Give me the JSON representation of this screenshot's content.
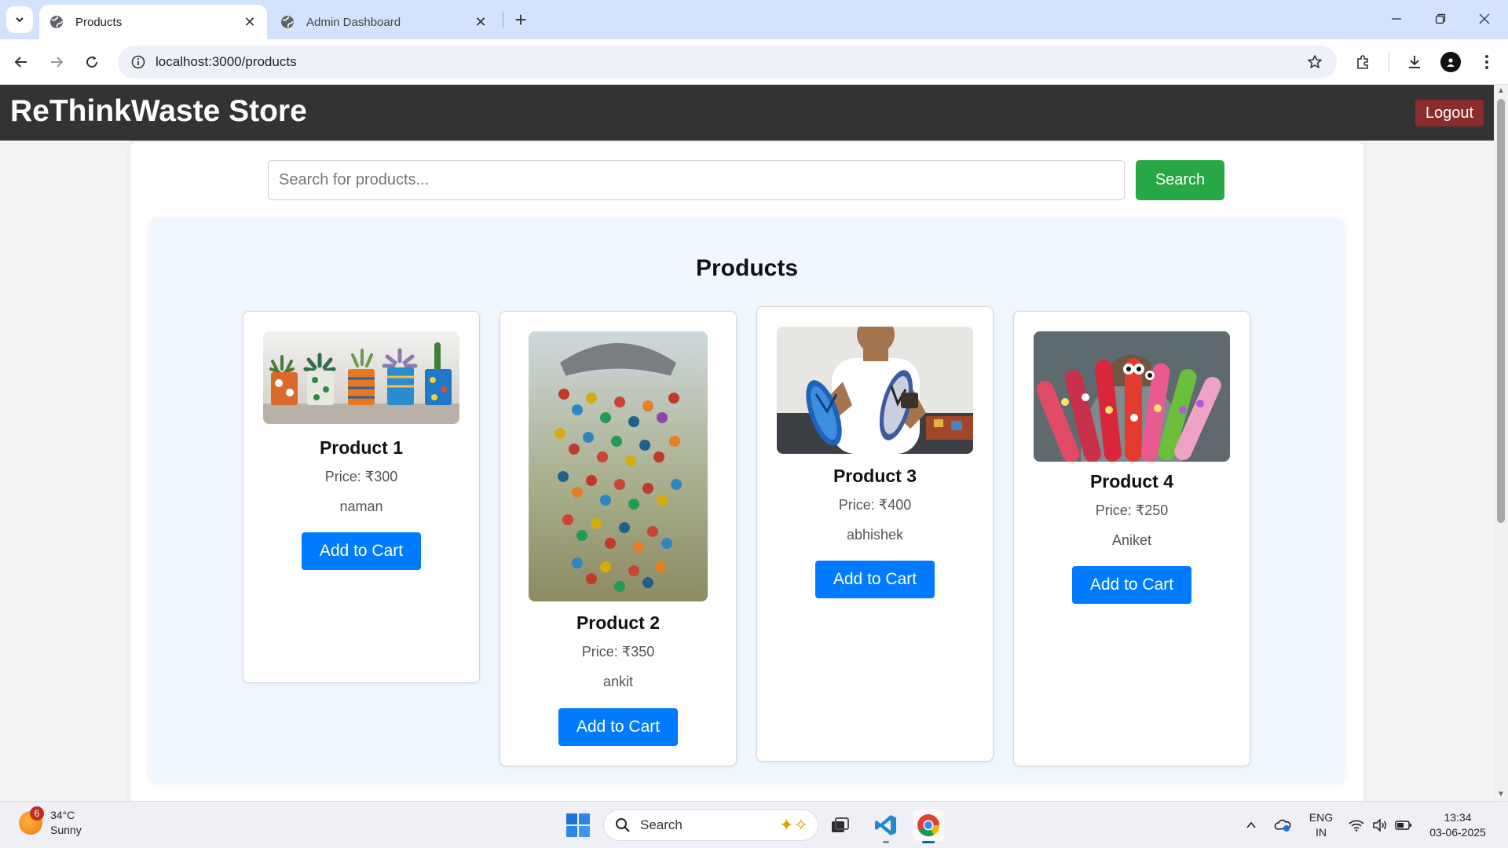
{
  "browser": {
    "tabs": [
      {
        "title": "Products",
        "active": true
      },
      {
        "title": "Admin Dashboard",
        "active": false
      }
    ],
    "url": "localhost:3000/products"
  },
  "site": {
    "title": "ReThinkWaste Store",
    "logout_label": "Logout",
    "search_placeholder": "Search for products...",
    "search_label": "Search",
    "products_heading": "Products"
  },
  "products": [
    {
      "name": "Product 1",
      "price": "Price: ₹300",
      "seller": "naman",
      "cart_label": "Add to Cart",
      "image": "upcycled-painted-plant-pots"
    },
    {
      "name": "Product 2",
      "price": "Price: ₹350",
      "seller": "ankit",
      "cart_label": "Add to Cart",
      "image": "bottle-cap-wind-chime"
    },
    {
      "name": "Product 3",
      "price": "Price: ₹400",
      "seller": "abhishek",
      "cart_label": "Add to Cart",
      "image": "recycled-flip-flops"
    },
    {
      "name": "Product 4",
      "price": "Price: ₹250",
      "seller": "Aniket",
      "cart_label": "Add to Cart",
      "image": "painted-ice-cream-sticks"
    }
  ],
  "taskbar": {
    "weather_badge": "6",
    "temperature": "34°C",
    "condition": "Sunny",
    "search_label": "Search",
    "language_line1": "ENG",
    "language_line2": "IN",
    "time": "13:34",
    "date": "03-06-2025"
  },
  "colors": {
    "header_bg": "#333333",
    "logout_bg": "#8b2c2c",
    "search_btn": "#28a745",
    "cart_btn": "#007bff",
    "panel_bg": "#f0f7ff"
  }
}
